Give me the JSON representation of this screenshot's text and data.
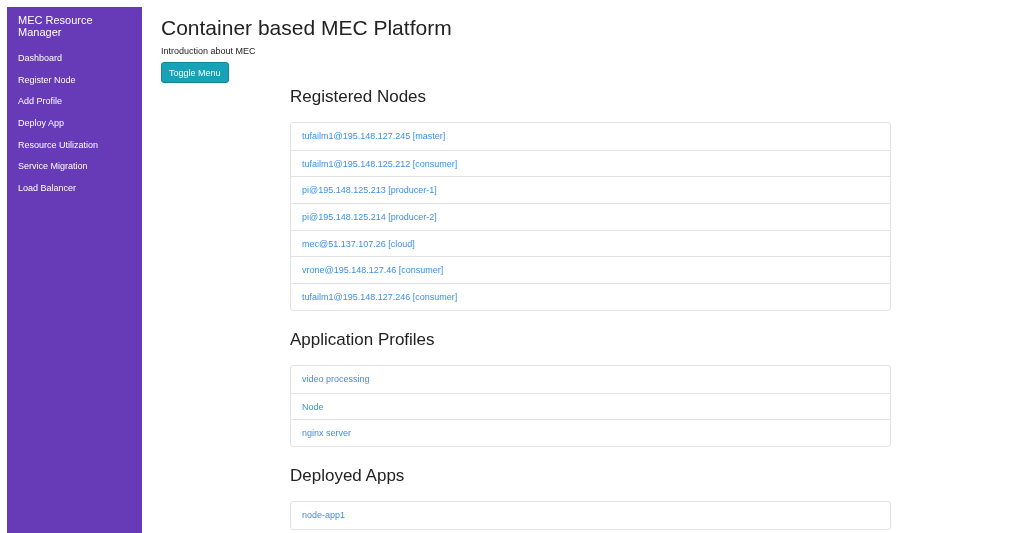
{
  "sidebar": {
    "brand": "MEC Resource Manager",
    "items": [
      "Dashboard",
      "Register Node",
      "Add Profile",
      "Deploy App",
      "Resource Utilization",
      "Service Migration",
      "Load Balancer"
    ]
  },
  "header": {
    "title": "Container based MEC Platform",
    "subtitle": "Introduction about MEC",
    "toggle_button": "Toggle Menu"
  },
  "sections": [
    {
      "heading": "Registered Nodes",
      "items": [
        "tufailm1@195.148.127.245 [master]",
        "tufailm1@195.148.125.212 [consumer]",
        "pi@195.148.125.213 [producer-1]",
        "pi@195.148.125.214 [producer-2]",
        "mec@51.137.107.26 [cloud]",
        "vrone@195.148.127.46 [consumer]",
        "tufailm1@195.148.127.246 [consumer]"
      ]
    },
    {
      "heading": "Application Profiles",
      "items": [
        "video processing",
        "Node",
        "nginx server"
      ]
    },
    {
      "heading": "Deployed Apps",
      "items": [
        "node-app1"
      ]
    }
  ]
}
